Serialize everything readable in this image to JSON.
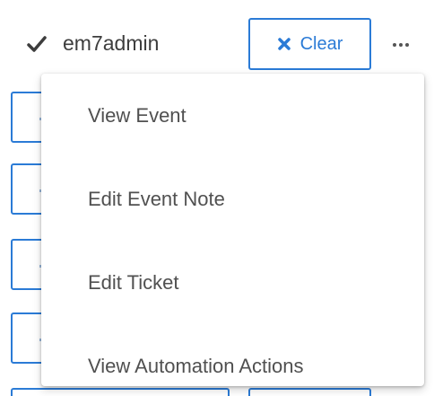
{
  "user": {
    "name": "em7admin",
    "icon": "check-icon"
  },
  "toolbar": {
    "clear_label": "Clear",
    "clear_icon": "close-icon",
    "more_icon": "ellipsis-icon"
  },
  "menu": {
    "items": [
      {
        "label": "View Event"
      },
      {
        "label": "Edit Event Note"
      },
      {
        "label": "Edit Ticket"
      },
      {
        "label": "View Automation Actions"
      }
    ]
  },
  "colors": {
    "accent": "#2b7bd6",
    "text": "#3d3d3d",
    "menu_text": "#505050"
  }
}
